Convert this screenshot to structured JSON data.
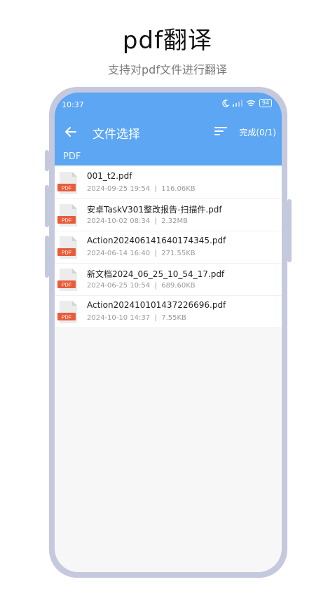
{
  "promo": {
    "title": "pdf翻译",
    "subtitle": "支持对pdf文件进行翻译"
  },
  "status_bar": {
    "time": "10:37",
    "battery": "94"
  },
  "toolbar": {
    "title": "文件选择",
    "done_label": "完成(0/1)",
    "back_icon": "arrow-left-icon",
    "sort_icon": "sort-icon"
  },
  "path": {
    "label": "PDF"
  },
  "files": [
    {
      "name": "001_t2.pdf",
      "date": "2024-09-25 19:54",
      "size": "116.06KB"
    },
    {
      "name": "安卓TaskV301整改报告-扫描件.pdf",
      "date": "2024-10-02 08:34",
      "size": "2.32MB"
    },
    {
      "name": "Action202406141640174345.pdf",
      "date": "2024-06-14 16:40",
      "size": "271.55KB"
    },
    {
      "name": "新文档2024_06_25_10_54_17.pdf",
      "date": "2024-06-25 10:54",
      "size": "689.60KB"
    },
    {
      "name": "Action202410101437226696.pdf",
      "date": "2024-10-10 14:37",
      "size": "7.55KB"
    }
  ],
  "file_icon_label": "PDF",
  "colors": {
    "accent": "#5ca6f3",
    "pdf_badge": "#e85c3a",
    "frame": "#c5c9de"
  }
}
